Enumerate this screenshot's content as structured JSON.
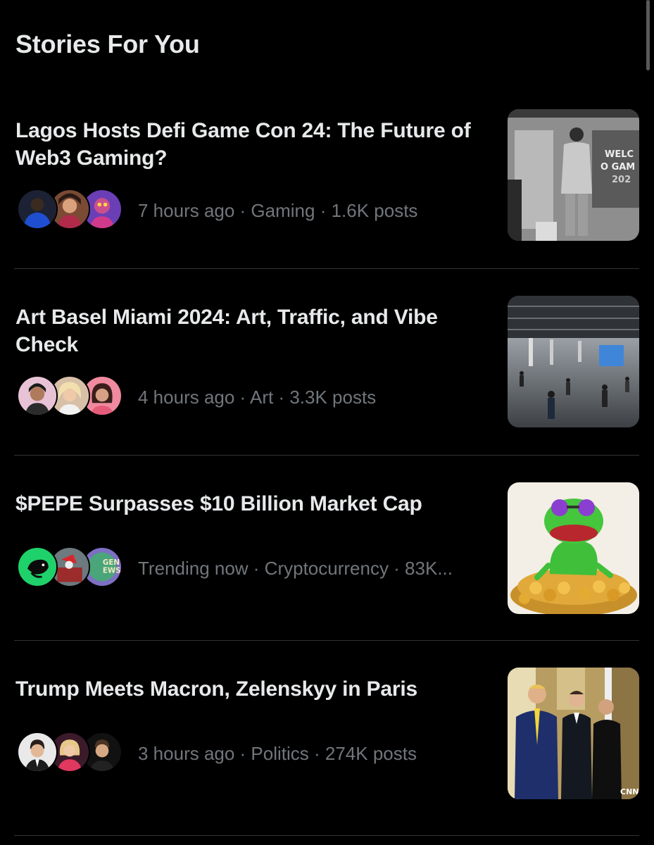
{
  "header": {
    "title": "Stories For You"
  },
  "stories": [
    {
      "title": "Lagos Hosts Defi Game Con 24: The Future of Web3 Gaming?",
      "meta": "7 hours ago · Gaming · 1.6K posts",
      "image": "defi-game-con-photo"
    },
    {
      "title": "Art Basel Miami 2024: Art, Traffic, and Vibe Check",
      "meta": "4 hours ago · Art · 3.3K posts",
      "image": "art-basel-hall-photo"
    },
    {
      "title": "$PEPE Surpasses $10 Billion Market Cap",
      "meta": "Trending now · Cryptocurrency · 83K...",
      "image": "pepe-frog-coins-image",
      "avatar_badge_text": "GEN EWS"
    },
    {
      "title": "Trump Meets Macron, Zelenskyy in Paris",
      "meta": "3 hours ago · Politics · 274K posts",
      "image": "leaders-meeting-photo"
    }
  ],
  "colors": {
    "background": "#000000",
    "title_text": "#e7e9ea",
    "meta_text": "#71767b",
    "divider": "#2f3336"
  }
}
